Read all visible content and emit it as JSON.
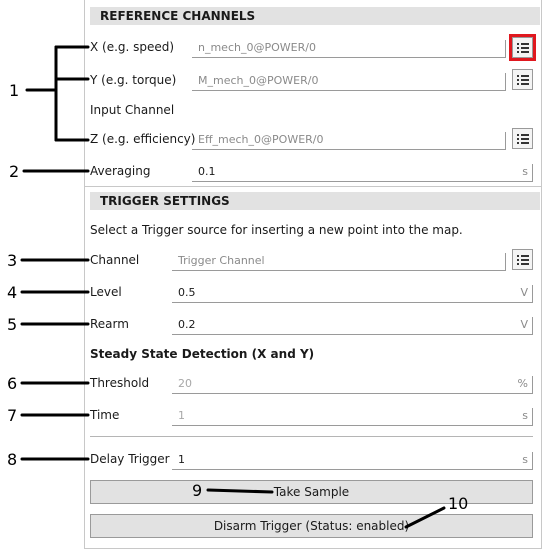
{
  "reference_channels": {
    "header": "REFERENCE CHANNELS",
    "x_label": "X (e.g. speed)",
    "x_value": "n_mech_0@POWER/0",
    "y_label": "Y (e.g. torque)",
    "y_value": "M_mech_0@POWER/0",
    "input_channel_label": "Input Channel",
    "z_label": "Z (e.g. efficiency)",
    "z_value": "Eff_mech_0@POWER/0",
    "averaging_label": "Averaging",
    "averaging_value": "0.1",
    "averaging_unit": "s"
  },
  "trigger_settings": {
    "header": "TRIGGER SETTINGS",
    "description": "Select a Trigger source for inserting a new point into the map.",
    "channel_label": "Channel",
    "channel_placeholder": "Trigger Channel",
    "level_label": "Level",
    "level_value": "0.5",
    "level_unit": "V",
    "rearm_label": "Rearm",
    "rearm_value": "0.2",
    "rearm_unit": "V",
    "steady_state_title": "Steady State Detection (X and Y)",
    "threshold_label": "Threshold",
    "threshold_value": "20",
    "threshold_unit": "%",
    "time_label": "Time",
    "time_value": "1",
    "time_unit": "s",
    "delay_label": "Delay Trigger",
    "delay_value": "1",
    "delay_unit": "s",
    "take_sample_label": "Take Sample",
    "disarm_label": "Disarm Trigger (Status: enabled)"
  },
  "callouts": [
    "1",
    "2",
    "3",
    "4",
    "5",
    "6",
    "7",
    "8",
    "9",
    "10"
  ],
  "colors": {
    "highlight": "#e0181f",
    "header_bg": "#e2e2e2"
  },
  "icons": {
    "list_button": "list-icon"
  }
}
